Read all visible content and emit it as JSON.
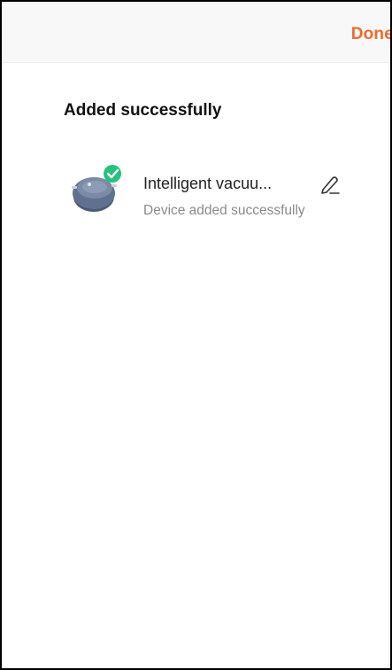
{
  "header": {
    "done_label": "Done"
  },
  "section": {
    "title": "Added successfully"
  },
  "device": {
    "name": "Intelligent vacuu...",
    "status": "Device added successfully",
    "icon": "robot-vacuum-icon",
    "badge_icon": "check-badge-icon",
    "edit_icon": "pencil-edit-icon"
  },
  "colors": {
    "accent": "#ef6a2c",
    "success": "#27c07f",
    "vacuum_body": "#5f718e"
  }
}
